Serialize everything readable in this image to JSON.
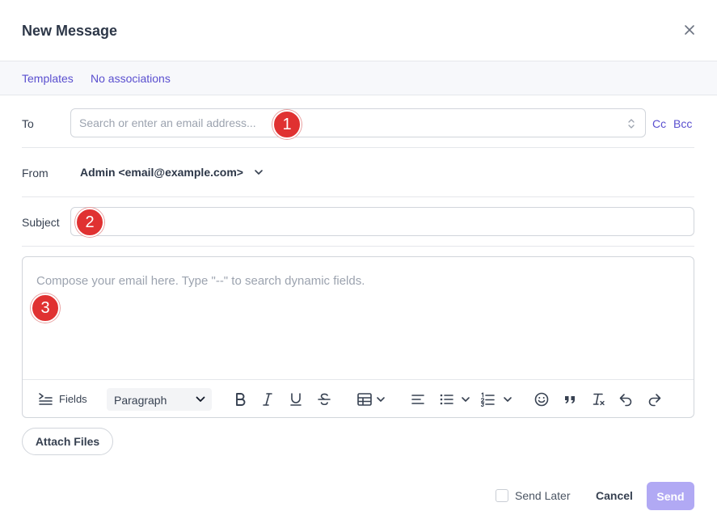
{
  "dialog": {
    "title": "New Message"
  },
  "links": {
    "templates": "Templates",
    "associations": "No associations"
  },
  "to": {
    "label": "To",
    "placeholder": "Search or enter an email address...",
    "value": "",
    "cc": "Cc",
    "bcc": "Bcc"
  },
  "from": {
    "label": "From",
    "value": "Admin <email@example.com>"
  },
  "subject": {
    "label": "Subject",
    "value": ""
  },
  "editor": {
    "placeholder": "Compose your email here. Type \"--\" to search dynamic fields.",
    "fields_label": "Fields",
    "paragraph_label": "Paragraph"
  },
  "footer": {
    "attach_label": "Attach Files",
    "send_later_label": "Send Later",
    "cancel_label": "Cancel",
    "send_label": "Send"
  },
  "annotations": [
    "1",
    "2",
    "3"
  ],
  "colors": {
    "accent": "#5a4fcf",
    "send_disabled": "#b1a9f4",
    "badge": "#e03131"
  }
}
